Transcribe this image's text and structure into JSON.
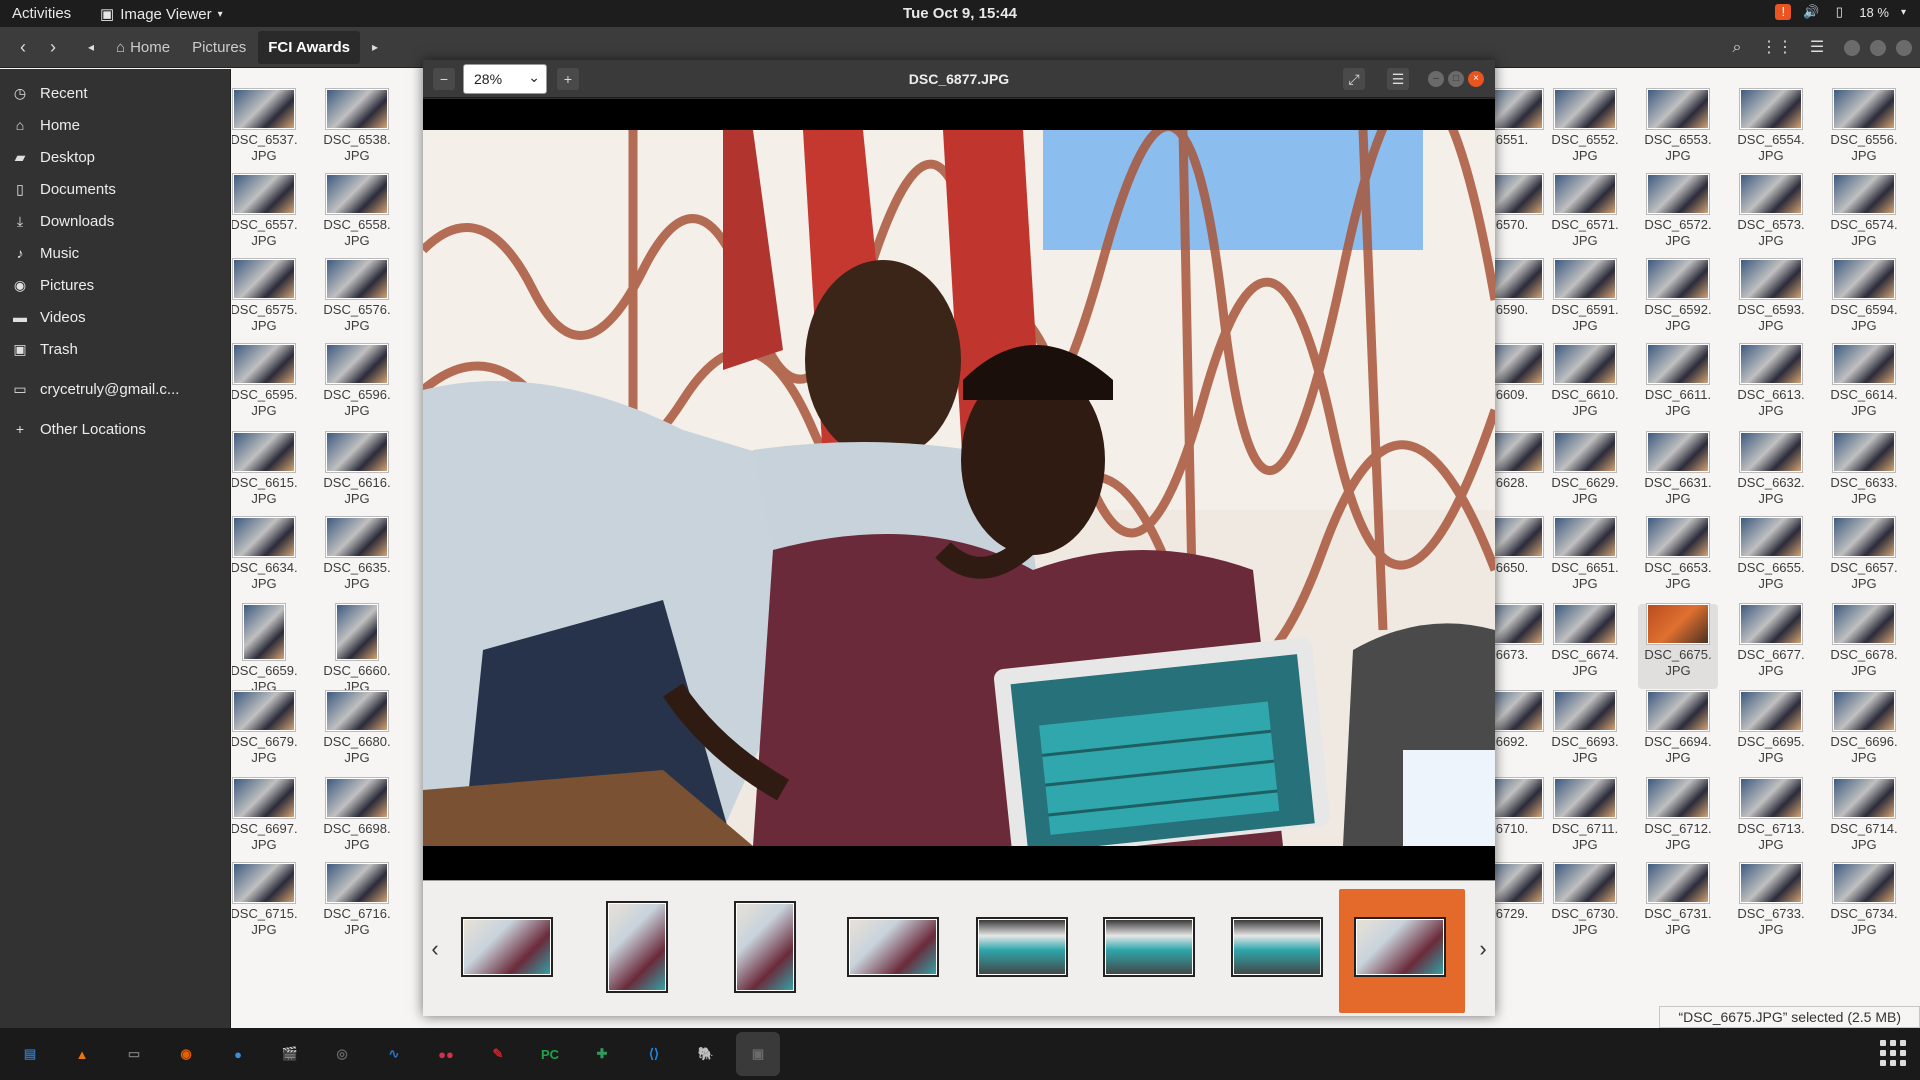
{
  "topbar": {
    "activities": "Activities",
    "app_menu": "Image Viewer",
    "clock": "Tue Oct  9, 15:44",
    "battery": "18 %"
  },
  "files": {
    "breadcrumbs": [
      "Home",
      "Pictures",
      "FCI Awards"
    ],
    "sidebar": [
      {
        "label": "Recent",
        "icon": "clock-icon"
      },
      {
        "label": "Home",
        "icon": "home-icon"
      },
      {
        "label": "Desktop",
        "icon": "folder-icon"
      },
      {
        "label": "Documents",
        "icon": "document-icon"
      },
      {
        "label": "Downloads",
        "icon": "download-icon"
      },
      {
        "label": "Music",
        "icon": "music-icon"
      },
      {
        "label": "Pictures",
        "icon": "camera-icon"
      },
      {
        "label": "Videos",
        "icon": "video-icon"
      },
      {
        "label": "Trash",
        "icon": "trash-icon"
      },
      {
        "label": "crycetruly@gmail.c...",
        "icon": "account-icon"
      },
      {
        "label": "Other Locations",
        "icon": "plus-icon"
      }
    ],
    "left_columns": [
      [
        "DSC_6537.",
        "DSC_6538."
      ],
      [
        "DSC_6557.",
        "DSC_6558."
      ],
      [
        "DSC_6575.",
        "DSC_6576."
      ],
      [
        "DSC_6595.",
        "DSC_6596."
      ],
      [
        "DSC_6615.",
        "DSC_6616."
      ],
      [
        "DSC_6634.",
        "DSC_6635."
      ],
      [
        "DSC_6659.",
        "DSC_6660."
      ],
      [
        "DSC_6679.",
        "DSC_6680."
      ],
      [
        "DSC_6697.",
        "DSC_6698."
      ],
      [
        "DSC_6715.",
        "DSC_6716."
      ]
    ],
    "partial_column": [
      "6551.",
      "6570.",
      "6590.",
      "6609.",
      "6628.",
      "6650.",
      "6673.",
      "6692.",
      "6710.",
      "6729."
    ],
    "right_columns": [
      [
        "DSC_6552.",
        "DSC_6553.",
        "DSC_6554.",
        "DSC_6556."
      ],
      [
        "DSC_6571.",
        "DSC_6572.",
        "DSC_6573.",
        "DSC_6574."
      ],
      [
        "DSC_6591.",
        "DSC_6592.",
        "DSC_6593.",
        "DSC_6594."
      ],
      [
        "DSC_6610.",
        "DSC_6611.",
        "DSC_6613.",
        "DSC_6614."
      ],
      [
        "DSC_6629.",
        "DSC_6631.",
        "DSC_6632.",
        "DSC_6633."
      ],
      [
        "DSC_6651.",
        "DSC_6653.",
        "DSC_6655.",
        "DSC_6657."
      ],
      [
        "DSC_6674.",
        "DSC_6675.",
        "DSC_6677.",
        "DSC_6678."
      ],
      [
        "DSC_6693.",
        "DSC_6694.",
        "DSC_6695.",
        "DSC_6696."
      ],
      [
        "DSC_6711.",
        "DSC_6712.",
        "DSC_6713.",
        "DSC_6714."
      ],
      [
        "DSC_6730.",
        "DSC_6731.",
        "DSC_6733.",
        "DSC_6734."
      ]
    ],
    "ext": "JPG",
    "selected": "DSC_6675.",
    "status": "“DSC_6675.JPG” selected  (2.5 MB)"
  },
  "viewer": {
    "title": "DSC_6877.JPG",
    "zoom": "28%",
    "zoom_out_icon": "minus-icon",
    "zoom_in_icon": "plus-icon",
    "fullscreen_icon": "fullscreen-icon",
    "menu_icon": "hamburger-icon",
    "gallery_count": 8,
    "gallery_selected": 8
  },
  "dock": [
    "Text Editor",
    "VLC",
    "Files",
    "Firefox",
    "Chrome",
    "Videos",
    "Screenshot",
    "System Monitor",
    "Flickr",
    "Evince",
    "PyCharm",
    "Android Studio",
    "VS Code",
    "PostgreSQL",
    "Image Viewer"
  ]
}
